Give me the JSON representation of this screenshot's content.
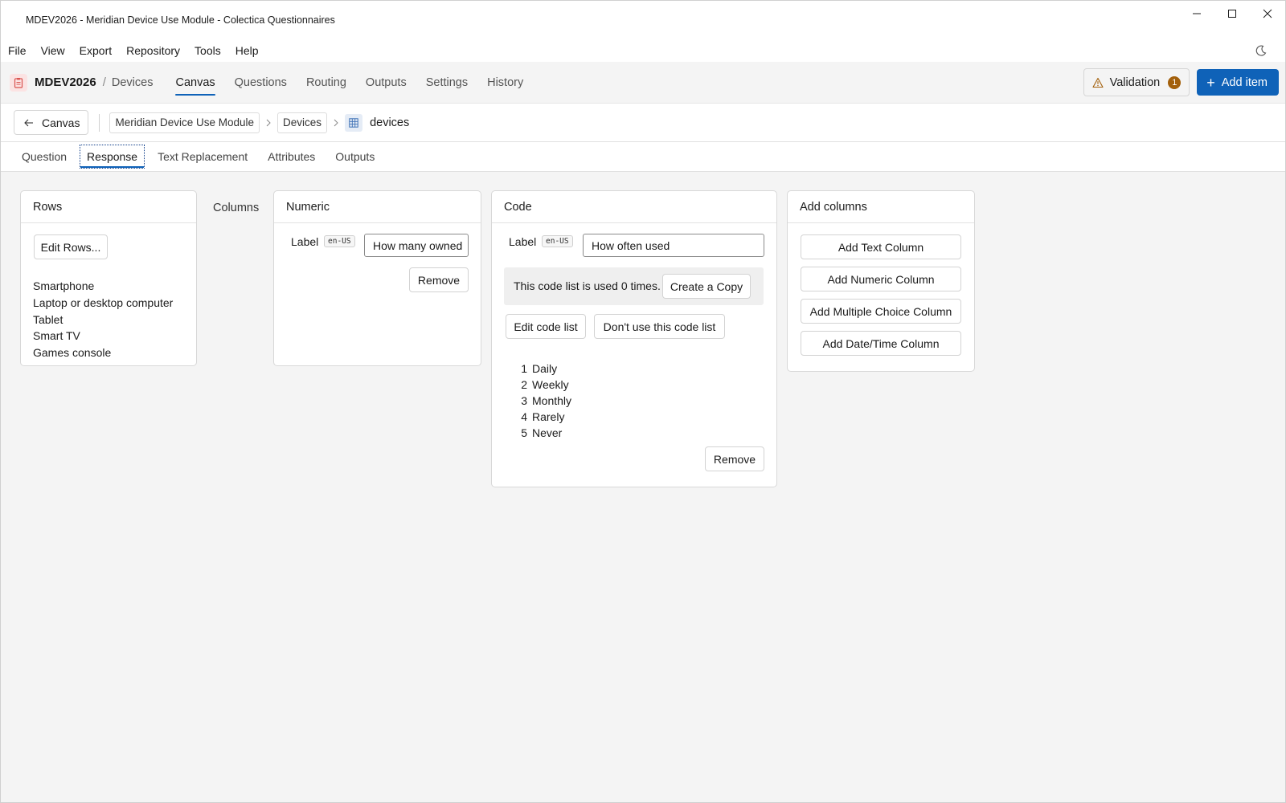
{
  "window": {
    "title": "MDEV2026 - Meridian Device Use Module - Colectica Questionnaires"
  },
  "menu": [
    "File",
    "View",
    "Export",
    "Repository",
    "Tools",
    "Help"
  ],
  "header": {
    "project": "MDEV2026",
    "separator": "/",
    "section": "Devices",
    "tabs": [
      "Canvas",
      "Questions",
      "Routing",
      "Outputs",
      "Settings",
      "History"
    ],
    "active_tab": "Canvas",
    "validation_label": "Validation",
    "validation_count": "1",
    "add_item_label": "Add item",
    "add_item_plus": "+"
  },
  "breadcrumb": {
    "back_label": "Canvas",
    "items": [
      "Meridian Device Use Module",
      "Devices"
    ],
    "current": "devices"
  },
  "subtabs": [
    "Question",
    "Response",
    "Text Replacement",
    "Attributes",
    "Outputs"
  ],
  "active_subtab": "Response",
  "rows_card": {
    "title": "Rows",
    "edit_button": "Edit Rows...",
    "rows": [
      "Smartphone",
      "Laptop or desktop computer",
      "Tablet",
      "Smart TV",
      "Games console"
    ]
  },
  "columns_label": "Columns",
  "numeric_card": {
    "title": "Numeric",
    "label_text": "Label",
    "lang": "en-US",
    "value": "How many owned",
    "remove_button": "Remove"
  },
  "code_card": {
    "title": "Code",
    "label_text": "Label",
    "lang": "en-US",
    "value": "How often used",
    "usage_text": "This code list is used 0 times.",
    "copy_button": "Create a Copy",
    "edit_button": "Edit code list",
    "dont_use_button": "Don't use this code list",
    "codes": [
      {
        "n": "1",
        "label": "Daily"
      },
      {
        "n": "2",
        "label": "Weekly"
      },
      {
        "n": "3",
        "label": "Monthly"
      },
      {
        "n": "4",
        "label": "Rarely"
      },
      {
        "n": "5",
        "label": "Never"
      }
    ],
    "remove_button": "Remove"
  },
  "add_columns_card": {
    "title": "Add columns",
    "buttons": [
      "Add Text Column",
      "Add Numeric Column",
      "Add Multiple Choice Column",
      "Add Date/Time Column"
    ]
  },
  "colors": {
    "accent": "#0f62b8",
    "badge": "#a3600c",
    "logo_bg": "#fbe3e3",
    "logo_fg": "#d9534f"
  }
}
